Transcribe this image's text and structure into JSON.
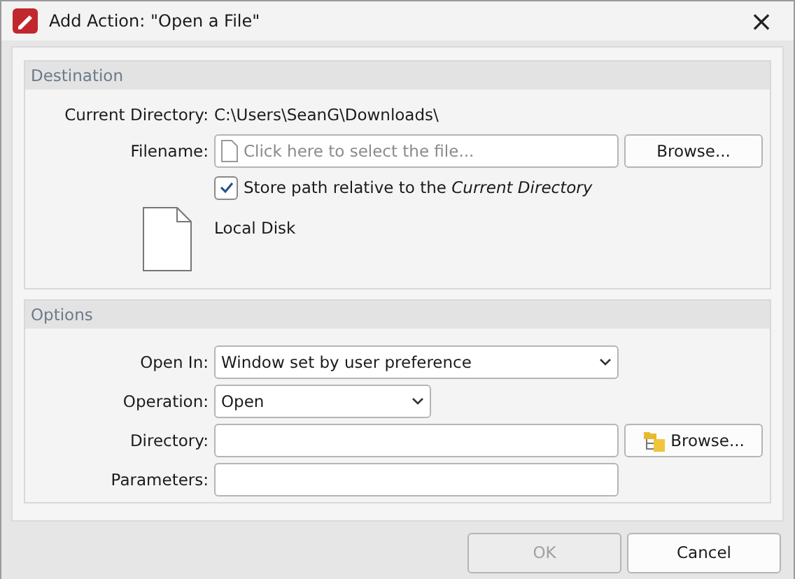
{
  "window": {
    "title": "Add Action: \"Open a File\"",
    "close": "×"
  },
  "destination": {
    "header": "Destination",
    "current_directory": {
      "label": "Current Directory:",
      "value": "C:\\Users\\SeanG\\Downloads\\"
    },
    "filename": {
      "label": "Filename:",
      "placeholder": "Click here to select the file...",
      "button": "Browse..."
    },
    "store_relative": {
      "label": "Store path relative to the *Current Directory*",
      "checked": true
    },
    "file_info": {
      "name": "Local Disk"
    }
  },
  "options": {
    "header": "Options",
    "rows": [
      {
        "kind": "select",
        "label": "Open In:",
        "value": "Window set by user preference",
        "wide": true
      },
      {
        "kind": "select",
        "label": "Operation:",
        "value": "Open",
        "wide": false
      },
      {
        "kind": "browse",
        "label": "Directory:",
        "value": "",
        "button": "Browse..."
      },
      {
        "kind": "input",
        "label": "Parameters:",
        "value": ""
      }
    ]
  },
  "buttons": [
    {
      "label": "OK",
      "disabled": true
    },
    {
      "label": "Cancel",
      "disabled": false
    }
  ]
}
